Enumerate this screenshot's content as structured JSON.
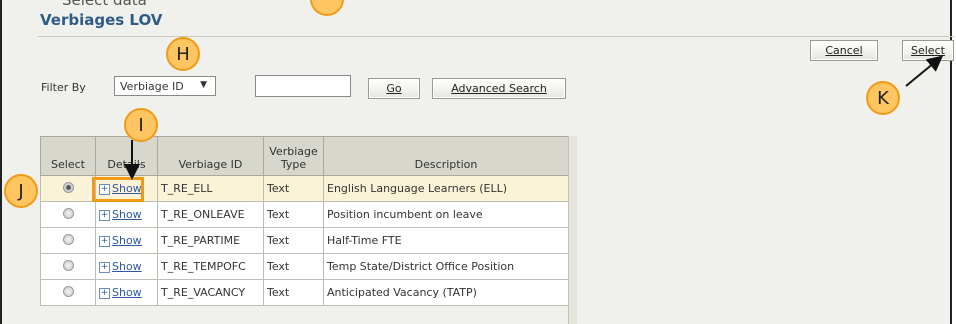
{
  "page_title": "Verbiages LOV",
  "partial_top_text": "Select data",
  "buttons": {
    "cancel": "Cancel",
    "select": "Select",
    "go": "Go",
    "advanced_search": "Advanced Search"
  },
  "filter": {
    "label": "Filter By",
    "selected_option": "Verbiage ID",
    "search_value": ""
  },
  "callouts": [
    "H",
    "I",
    "J",
    "K"
  ],
  "table": {
    "columns": [
      "Select",
      "Details",
      "Verbiage ID",
      "Verbiage Type",
      "Description"
    ],
    "rows": [
      {
        "selected": true,
        "details": "Show",
        "id": "T_RE_ELL",
        "type": "Text",
        "description": "English Language Learners (ELL)"
      },
      {
        "selected": false,
        "details": "Show",
        "id": "T_RE_ONLEAVE",
        "type": "Text",
        "description": "Position incumbent on leave"
      },
      {
        "selected": false,
        "details": "Show",
        "id": "T_RE_PARTIME",
        "type": "Text",
        "description": "Half-Time FTE"
      },
      {
        "selected": false,
        "details": "Show",
        "id": "T_RE_TEMPOFC",
        "type": "Text",
        "description": "Temp State/District Office Position"
      },
      {
        "selected": false,
        "details": "Show",
        "id": "T_RE_VACANCY",
        "type": "Text",
        "description": "Anticipated Vacancy (TATP)"
      }
    ]
  },
  "colors": {
    "title": "#2e5b87",
    "callout_fill": "#ffc560",
    "callout_border": "#f29a18",
    "selected_row": "#fbf3d8",
    "header_bg": "#d7d7cd"
  }
}
